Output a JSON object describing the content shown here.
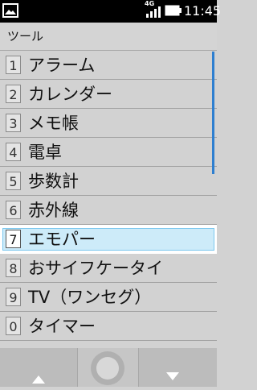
{
  "status": {
    "network": "4G",
    "time": "11:45",
    "icons": [
      "gallery-icon",
      "signal-icon",
      "battery-icon"
    ]
  },
  "header": {
    "title": "ツール"
  },
  "menu": {
    "items": [
      {
        "num": "1",
        "label": "アラーム"
      },
      {
        "num": "2",
        "label": "カレンダー"
      },
      {
        "num": "3",
        "label": "メモ帳"
      },
      {
        "num": "4",
        "label": "電卓"
      },
      {
        "num": "5",
        "label": "歩数計"
      },
      {
        "num": "6",
        "label": "赤外線"
      },
      {
        "num": "7",
        "label": "エモパー"
      },
      {
        "num": "8",
        "label": "おサイフケータイ"
      },
      {
        "num": "9",
        "label": "TV（ワンセグ）"
      },
      {
        "num": "0",
        "label": "タイマー"
      }
    ],
    "selected_index": 6
  },
  "softkeys": {
    "left_icon": "up-arrow-icon",
    "center_icon": "center-circle-icon",
    "right_icon": "down-arrow-icon"
  },
  "colors": {
    "selection_fill": "#cdebf9",
    "selection_border": "#7cc7ee",
    "scrollbar": "#2e7fd0"
  }
}
